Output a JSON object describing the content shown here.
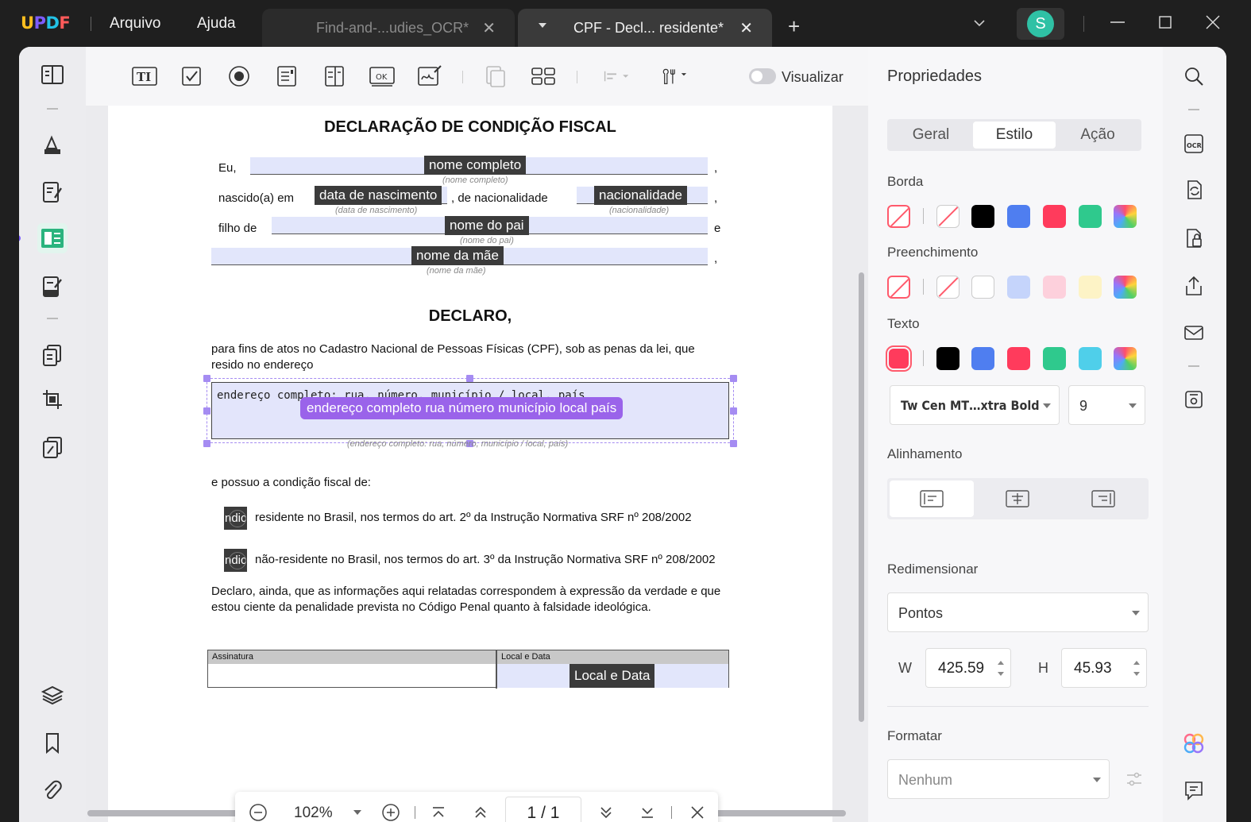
{
  "app": {
    "logo": "UPDF",
    "menu": [
      "Arquivo",
      "Ajuda"
    ],
    "tabs": [
      {
        "label": "Find-and-...udies_OCR*",
        "active": false
      },
      {
        "label": "CPF - Decl... residente*",
        "active": true
      }
    ],
    "avatar_initial": "S"
  },
  "toolbar": {
    "tool_icons": [
      "text-field-icon",
      "checkbox-icon",
      "radio-button-icon",
      "list-box-icon",
      "dropdown-icon",
      "ok-button-icon",
      "signature-icon",
      "duplicate-icon",
      "grid-icon",
      "align-icon",
      "tools-icon"
    ],
    "preview_label": "Visualizar",
    "preview_on": false
  },
  "document": {
    "title": "DECLARAÇÃO DE CONDIÇÃO FISCAL",
    "line1_prefix": "Eu,",
    "name_field": "nome completo",
    "name_hint": "(nome completo)",
    "line2_prefix": "nascido(a) em",
    "birth_field": "data de nascimento",
    "birth_hint": "(data de nascimento)",
    "nationality_text": ", de nacionalidade",
    "nationality_field": "nacionalidade",
    "nationality_hint": "(nacionalidade)",
    "line3_prefix": "filho de",
    "father_field": "nome do pai",
    "father_hint": "(nome do pai)",
    "conj_e": "e",
    "comma": ",",
    "mother_field": "nome da mãe",
    "mother_hint": "(nome da mãe)",
    "declaro": "DECLARO,",
    "para1": "para fins de atos no Cadastro Nacional de Pessoas Físicas (CPF), sob as penas da lei, que resido no endereço",
    "address_text": "endereço completo: rua, número, município / local, país",
    "address_tag": "endereço completo rua número município  local país",
    "address_hint": "(endereço completo: rua, número, município / local, país)",
    "fiscal_intro": "e possuo a condição fiscal de:",
    "checkbox_label": "ndic",
    "option1": "residente no Brasil, nos termos do art. 2º da Instrução Normativa SRF nº 208/2002",
    "option2": "não-residente no Brasil, nos termos do art. 3º da Instrução Normativa SRF nº 208/2002",
    "para2": "Declaro, ainda, que as informações aqui relatadas correspondem à expressão da verdade e que estou ciente da penalidade prevista no Código Penal quanto à falsidade ideológica.",
    "sig_head1": "Assinatura",
    "sig_head2": "Local e Data",
    "date_field": "Local e Data"
  },
  "zoombar": {
    "zoom": "102%",
    "page_current": "1",
    "page_sep": "/",
    "page_total": "1"
  },
  "properties": {
    "title": "Propriedades",
    "tabs": [
      "Geral",
      "Estilo",
      "Ação"
    ],
    "active_tab": "Estilo",
    "border_label": "Borda",
    "border_colors": [
      "#000000",
      "#4f7ef0",
      "#ff3b5c",
      "#2fc98d"
    ],
    "fill_label": "Preenchimento",
    "fill_colors": [
      "#ffffff",
      "#c5d4fb",
      "#fdd0dc",
      "#fdf3c6"
    ],
    "text_label": "Texto",
    "text_selected_color": "#ff3b5c",
    "text_colors": [
      "#000000",
      "#4f7ef0",
      "#ff3b5c",
      "#2fc98d",
      "#4fcfea"
    ],
    "font_name": "Tw Cen MT…xtra Bold",
    "font_size": "9",
    "alignment_label": "Alinhamento",
    "resize_label": "Redimensionar",
    "resize_unit": "Pontos",
    "w_label": "W",
    "w_value": "425.59",
    "h_label": "H",
    "h_value": "45.93",
    "format_label": "Formatar",
    "format_value": "Nenhum"
  }
}
